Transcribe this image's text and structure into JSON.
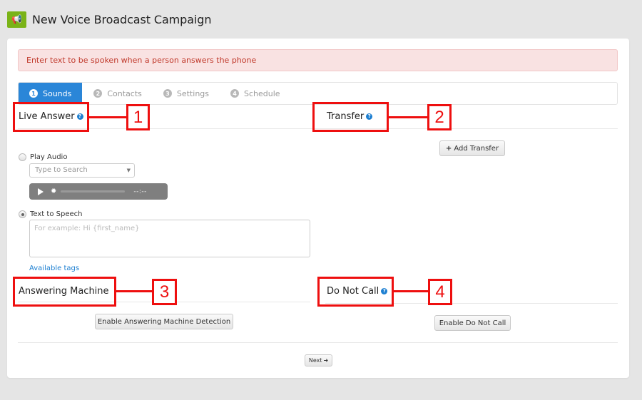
{
  "header": {
    "icon": "megaphone-icon",
    "title": "New Voice Broadcast Campaign",
    "icon_color": "#7ab317"
  },
  "alert": {
    "text": "Enter text to be spoken when a person answers the phone"
  },
  "tabs": [
    {
      "num": "1",
      "label": "Sounds",
      "active": true
    },
    {
      "num": "2",
      "label": "Contacts",
      "active": false
    },
    {
      "num": "3",
      "label": "Settings",
      "active": false
    },
    {
      "num": "4",
      "label": "Schedule",
      "active": false
    }
  ],
  "sections": {
    "live_answer": {
      "title": "Live Answer",
      "play_audio_label": "Play Audio",
      "search_placeholder": "Type to Search",
      "player_time": "--:--",
      "tts_label": "Text to Speech",
      "tts_placeholder": "For example: Hi {first_name}",
      "available_tags_link": "Available tags",
      "selected_option": "Text to Speech"
    },
    "transfer": {
      "title": "Transfer",
      "add_button": "Add Transfer"
    },
    "answering_machine": {
      "title": "Answering Machine",
      "button": "Enable Answering Machine Detection"
    },
    "do_not_call": {
      "title": "Do Not Call",
      "button": "Enable Do Not Call"
    }
  },
  "annotations": [
    "1",
    "2",
    "3",
    "4"
  ],
  "footer": {
    "next_button": "Next"
  },
  "colors": {
    "accent": "#2a86d8",
    "annotation": "#ee0f0f",
    "alert_text": "#c0392b",
    "link": "#1d7fd1"
  }
}
